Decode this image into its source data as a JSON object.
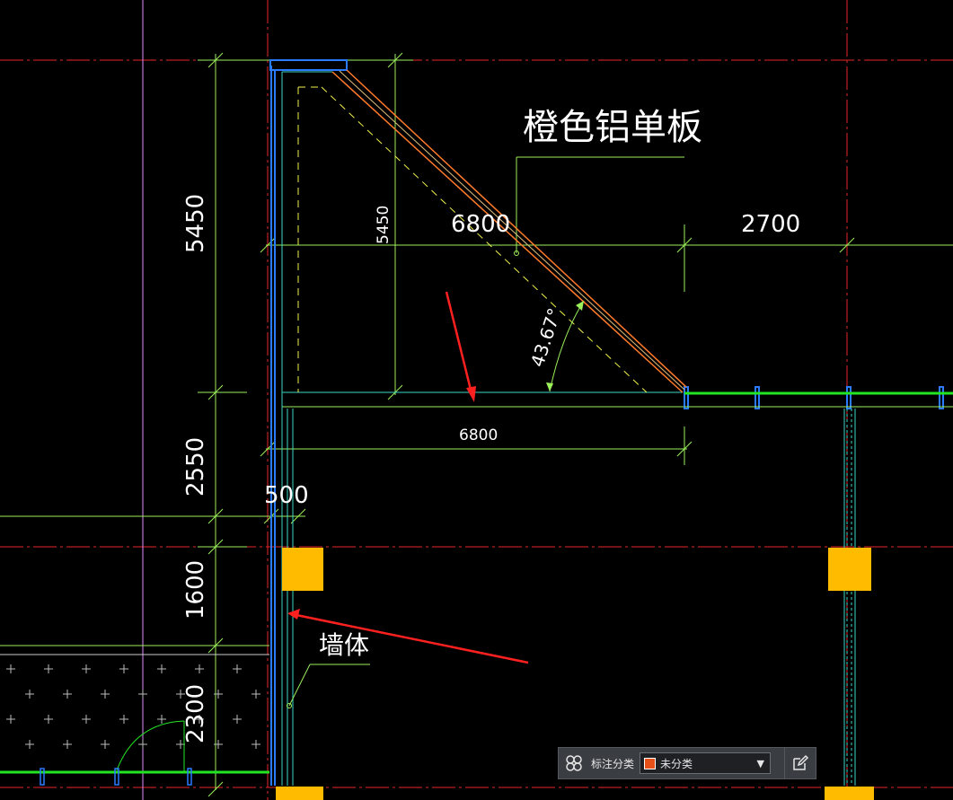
{
  "drawing": {
    "material_label": "橙色铝单板",
    "wall_label": "墙体",
    "dims": {
      "left_top": "5450",
      "inner_vertical": "5450",
      "slope_horizontal": "6800",
      "right_horizontal": "2700",
      "base_horizontal": "6800",
      "left_mid": "2550",
      "offset": "500",
      "left_lower": "1600",
      "left_bottom": "2300"
    },
    "angle": "43.67°",
    "colors": {
      "background": "#000000",
      "axis_red": "#e8262a",
      "dim_green": "#9cf05a",
      "wall_blue": "#2a7bff",
      "cyan": "#3cd6c8",
      "orange_panel": "#ff7a2a",
      "yellow_dash": "#f2f24a",
      "column_yellow": "#ffbb00",
      "magenta": "#e08aff",
      "annotation_arrow": "#ff2020"
    }
  },
  "toolbar": {
    "label": "标注分类",
    "selected_option": "未分类",
    "swatch_color": "#e8501a",
    "grid_icon": "grid-icon",
    "edit_icon": "edit-icon"
  }
}
